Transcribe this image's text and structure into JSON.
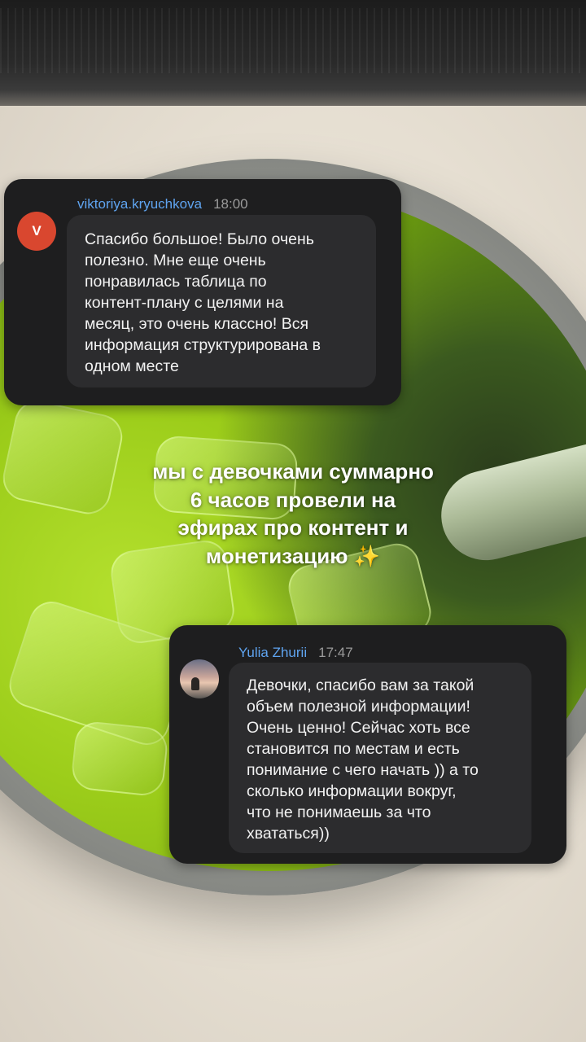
{
  "comments": [
    {
      "username": "viktoriya.kryuchkova",
      "time": "18:00",
      "avatar_letter": "V",
      "avatar_color": "#d9472f",
      "text": "Спасибо большое! Было очень\nполезно. Мне еще очень\nпонравилась таблица по\nконтент-плану с целями на\nмесяц, это очень классно! Вся\nинформация структурирована в\nодном месте"
    },
    {
      "username": "Yulia Zhurii",
      "time": "17:47",
      "text": "Девочки, спасибо вам за такой\nобъем полезной информации!\nОчень ценно! Сейчас хоть все\nстановится по местам и есть\nпонимание с чего начать )) а то\nсколько информации вокруг,\nчто не понимаешь за что\nхвататься))"
    }
  ],
  "caption": {
    "text": "мы с девочками суммарно\n6 часов провели на\nэфирах про контент и\nмонетизацию",
    "emoji": "✨"
  },
  "colors": {
    "card_bg": "#1e1e1f",
    "bubble_bg": "#2c2c2e",
    "username": "#5fa4f0",
    "time": "#9b9b9b"
  }
}
